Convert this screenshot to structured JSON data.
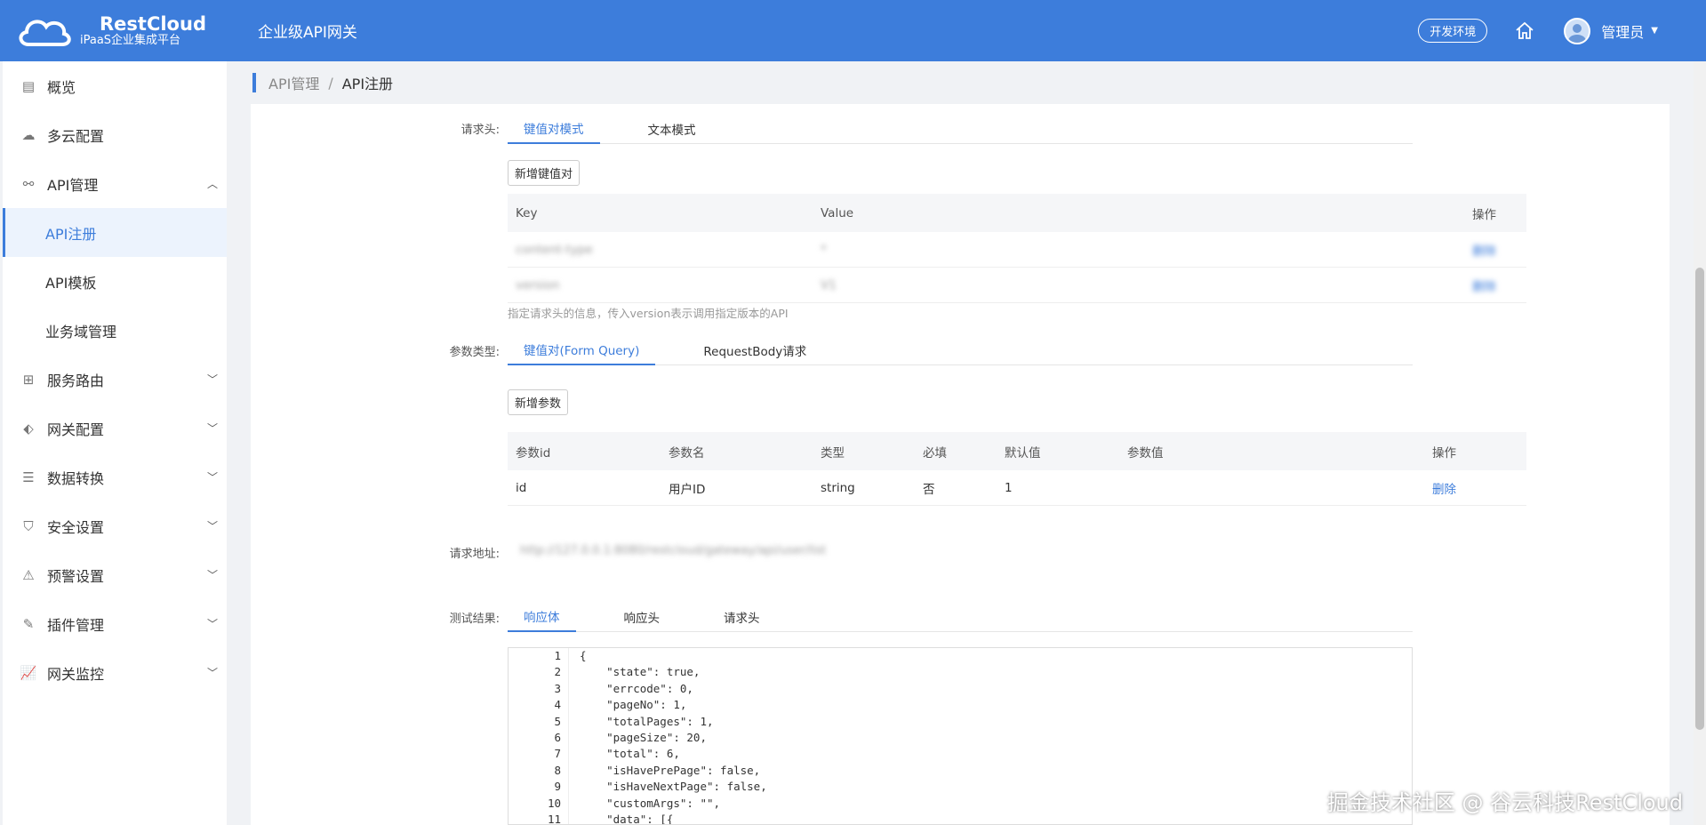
{
  "header": {
    "brand_title": "RestCloud",
    "brand_subtitle": "iPaaS企业集成平台",
    "title": "企业级API网关",
    "env_badge": "开发环境",
    "user_name": "管理员"
  },
  "sidebar": {
    "items": [
      {
        "label": "概览",
        "icon": "overview-icon"
      },
      {
        "label": "多云配置",
        "icon": "cloud-icon"
      },
      {
        "label": "API管理",
        "icon": "api-link-icon",
        "expanded": true
      },
      {
        "label": "API注册",
        "sub": true,
        "active": true
      },
      {
        "label": "API模板",
        "sub": true
      },
      {
        "label": "业务域管理",
        "sub": true
      },
      {
        "label": "服务路由",
        "icon": "grid-icon"
      },
      {
        "label": "网关配置",
        "icon": "tag-icon"
      },
      {
        "label": "数据转换",
        "icon": "data-icon"
      },
      {
        "label": "安全设置",
        "icon": "shield-icon"
      },
      {
        "label": "预警设置",
        "icon": "warning-icon"
      },
      {
        "label": "插件管理",
        "icon": "edit-icon"
      },
      {
        "label": "网关监控",
        "icon": "chart-icon"
      }
    ]
  },
  "breadcrumb": {
    "parent": "API管理",
    "separator": "/",
    "current": "API注册"
  },
  "request_headers": {
    "label": "请求头:",
    "tabs": [
      "键值对模式",
      "文本模式"
    ],
    "add_button": "新增键值对",
    "columns": {
      "key": "Key",
      "value": "Value",
      "op": "操作"
    },
    "rows": [
      {
        "key": "content-type",
        "value": "*",
        "op": "删除"
      },
      {
        "key": "version",
        "value": "V1",
        "op": "删除"
      }
    ],
    "hint": "指定请求头的信息，传入version表示调用指定版本的API"
  },
  "params": {
    "label": "参数类型:",
    "tabs": [
      "键值对(Form Query)",
      "RequestBody请求"
    ],
    "add_button": "新增参数",
    "columns": {
      "id": "参数id",
      "name": "参数名",
      "type": "类型",
      "required": "必填",
      "default": "默认值",
      "value": "参数值",
      "op": "操作"
    },
    "rows": [
      {
        "id": "id",
        "name": "用户ID",
        "type": "string",
        "required": "否",
        "default": "1",
        "value": "",
        "op": "删除"
      }
    ]
  },
  "request_url": {
    "label": "请求地址:",
    "value": "http://127.0.0.1:8080/restcloud/gateway/api/user/list"
  },
  "test_result": {
    "label": "测试结果:",
    "tabs": [
      "响应体",
      "响应头",
      "请求头"
    ],
    "line_numbers": [
      "1",
      "2",
      "3",
      "4",
      "5",
      "6",
      "7",
      "8",
      "9",
      "10",
      "11"
    ],
    "lines": [
      "{",
      "    \"state\": true,",
      "    \"errcode\": 0,",
      "    \"pageNo\": 1,",
      "    \"totalPages\": 1,",
      "    \"pageSize\": 20,",
      "    \"total\": 6,",
      "    \"isHavePrePage\": false,",
      "    \"isHaveNextPage\": false,",
      "    \"customArgs\": \"\",",
      "    \"data\": [{"
    ]
  },
  "watermark": "掘金技术社区 @ 谷云科技RestCloud",
  "colors": {
    "primary": "#3d7ddb",
    "header_bg": "#3d7ddb",
    "sidebar_active_bg": "#ecf3fd"
  }
}
